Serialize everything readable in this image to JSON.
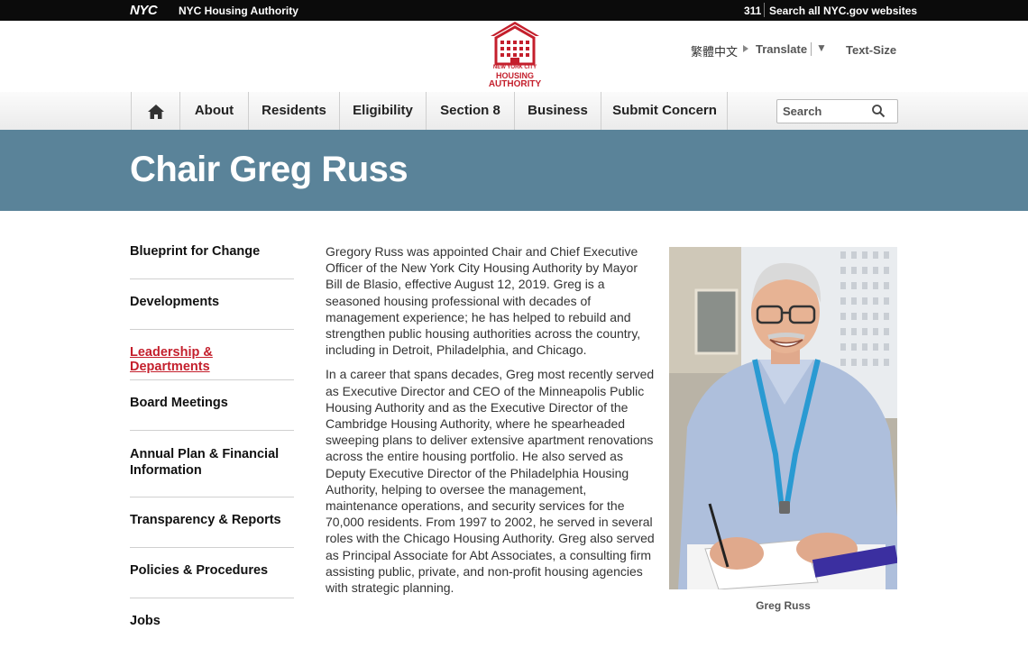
{
  "topbar": {
    "logo": "NYC",
    "agency": "NYC Housing Authority",
    "link_311": "311",
    "search_all": "Search all NYC.gov websites"
  },
  "header": {
    "logo_line1": "NEW YORK CITY",
    "logo_line2": "HOUSING",
    "logo_line3": "AUTHORITY",
    "chinese": "繁體中文",
    "translate": "Translate",
    "translate_arrow": "▼",
    "text_size": "Text-Size"
  },
  "nav": {
    "items": [
      "About",
      "Residents",
      "Eligibility",
      "Section 8",
      "Business",
      "Submit Concern"
    ],
    "search_placeholder": "Search"
  },
  "banner": {
    "title": "Chair Greg Russ"
  },
  "sidebar": {
    "items": [
      "Blueprint for Change",
      "Developments",
      "Leadership & Departments",
      "Board Meetings",
      "Annual Plan & Financial Information",
      "Transparency & Reports",
      "Policies & Procedures",
      "Jobs"
    ],
    "active_index": 2
  },
  "article": {
    "paragraphs": [
      "Gregory Russ was appointed Chair and Chief Executive Officer of the New York City Housing Authority by Mayor Bill de Blasio, effective August 12, 2019. Greg is a seasoned housing professional with decades of management experience; he has helped to rebuild and strengthen public housing authorities across the country, including in Detroit, Philadelphia, and Chicago.",
      "In a career that spans decades, Greg most recently served as Executive Director and CEO of the Minneapolis Public Housing Authority and as the Executive Director of the Cambridge Housing Authority, where he spearheaded sweeping plans to deliver extensive apartment renovations across the entire housing portfolio. He also served as Deputy Executive Director of the Philadelphia Housing Authority, helping to oversee the management, maintenance operations, and security services for the 70,000 residents. From 1997 to 2002, he served in several roles with the Chicago Housing Authority. Greg also served as Principal Associate for Abt Associates, a consulting firm assisting public, private, and non-profit housing agencies with strategic planning."
    ]
  },
  "photo": {
    "caption": "Greg Russ"
  },
  "colors": {
    "brand_red": "#c41f2c",
    "banner": "#5a8399",
    "topbar": "#0b0b0b"
  }
}
